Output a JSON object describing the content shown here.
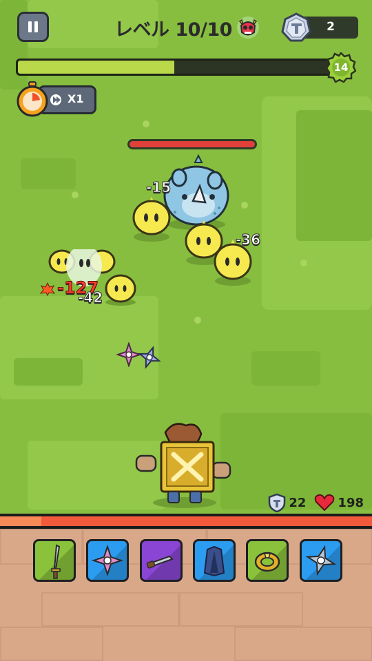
{
  "hud": {
    "level_label": "レベル 10/10",
    "coin_count": "2",
    "xp_progress": 0.49,
    "player_level": "14",
    "speed_label": "X1",
    "boss_hp_fraction": 1.0
  },
  "player": {
    "defense": "22",
    "health": "198",
    "hp_fraction": 1.0
  },
  "damage_numbers": [
    "-15",
    "-36",
    "-127",
    "-42"
  ],
  "skills": [
    {
      "name": "sword-icon",
      "color": "#8ac33b"
    },
    {
      "name": "shuriken-pink-icon",
      "color": "#2b9cf0"
    },
    {
      "name": "dagger-icon",
      "color": "#8a45d4"
    },
    {
      "name": "armor-icon",
      "color": "#2b9cf0"
    },
    {
      "name": "ring-icon",
      "color": "#8ac33b"
    },
    {
      "name": "shuriken-icon",
      "color": "#2b9cf0"
    }
  ],
  "colors": {
    "grass": "#87be40",
    "xp_fill": "#b9d84a",
    "hp_fill": "#f35a3b",
    "crit_text": "#ff3b2e"
  }
}
